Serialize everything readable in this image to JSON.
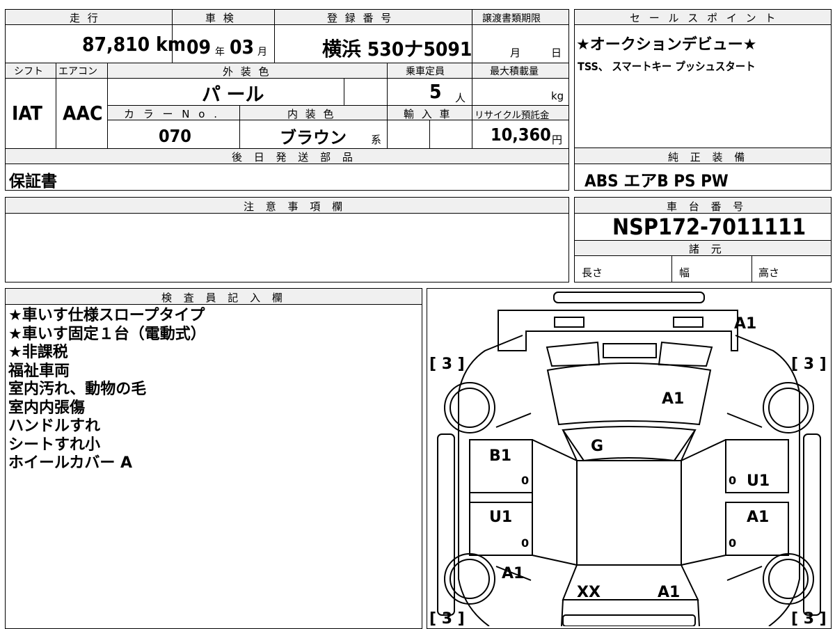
{
  "main_form": {
    "mileage_label": "走 行",
    "mileage_value": "87,810 km",
    "shaken_label": "車 検",
    "shaken_year": "09",
    "shaken_year_unit": "年",
    "shaken_month": "03",
    "shaken_month_unit": "月",
    "registration_label": "登 録 番 号",
    "registration_value": "横浜 530ナ5091",
    "transfer_deadline_label": "譲渡書類期限",
    "transfer_month_unit": "月",
    "transfer_day_unit": "日",
    "shift_label": "シフト",
    "shift_value": "IAT",
    "aircon_label": "エアコン",
    "aircon_value": "AAC",
    "exterior_color_label": "外 装 色",
    "exterior_color_value": "パ ール",
    "capacity_label": "乗車定員",
    "capacity_value": "5",
    "capacity_unit": "人",
    "max_load_label": "最大積載量",
    "max_load_unit": "kg",
    "color_no_label": "カ ラ ー N o .",
    "color_no_value": "070",
    "interior_color_label": "内 装 色",
    "interior_color_value": "ブラウン",
    "interior_color_suffix": "系",
    "import_label": "輸 入 車",
    "recycle_label": "リサイクル預託金",
    "recycle_value": "10,360",
    "recycle_unit": "円",
    "later_parts_label": "後 日 発 送 部 品",
    "later_parts_value": "保証書"
  },
  "sales_points": {
    "label": "セ ー ル ス ポ イ ン ト",
    "line1": "★オークションデビュー★",
    "line2": "TSS、 スマートキー プッシュスタート"
  },
  "genuine_equipment": {
    "label": "純 正 装 備",
    "value": "ABS エアB PS PW"
  },
  "caution": {
    "label": "注 意 事 項 欄"
  },
  "chassis": {
    "label": "車 台 番 号",
    "value": "NSP172-7011111",
    "specs_label": "諸 元",
    "length_label": "長さ",
    "width_label": "幅",
    "height_label": "高さ"
  },
  "inspector": {
    "label": "検 査 員 記 入 欄",
    "notes": [
      "★車いす仕様スロープタイプ",
      "★車いす固定１台（電動式）",
      "★非課税",
      "福祉車両",
      "室内汚れ、動物の毛",
      "室内内張傷",
      "ハンドルすれ",
      "シートすれ小",
      "ホイールカバー A"
    ]
  },
  "diagram": {
    "tire_tread": [
      "[ 3 ]",
      "[ 3 ]",
      "[ 3 ]",
      "[ 3 ]"
    ],
    "marks": {
      "front_bumper": "A1",
      "hood": "A1",
      "windshield": "G",
      "left_front_door": "B1",
      "right_front_door": "U1",
      "left_rear_door": "U1",
      "right_rear_door": "A1",
      "left_rear_fender": "A1",
      "roof": "XX",
      "rear_right": "A1"
    },
    "door_zero": [
      "0",
      "0",
      "0",
      "0"
    ]
  }
}
